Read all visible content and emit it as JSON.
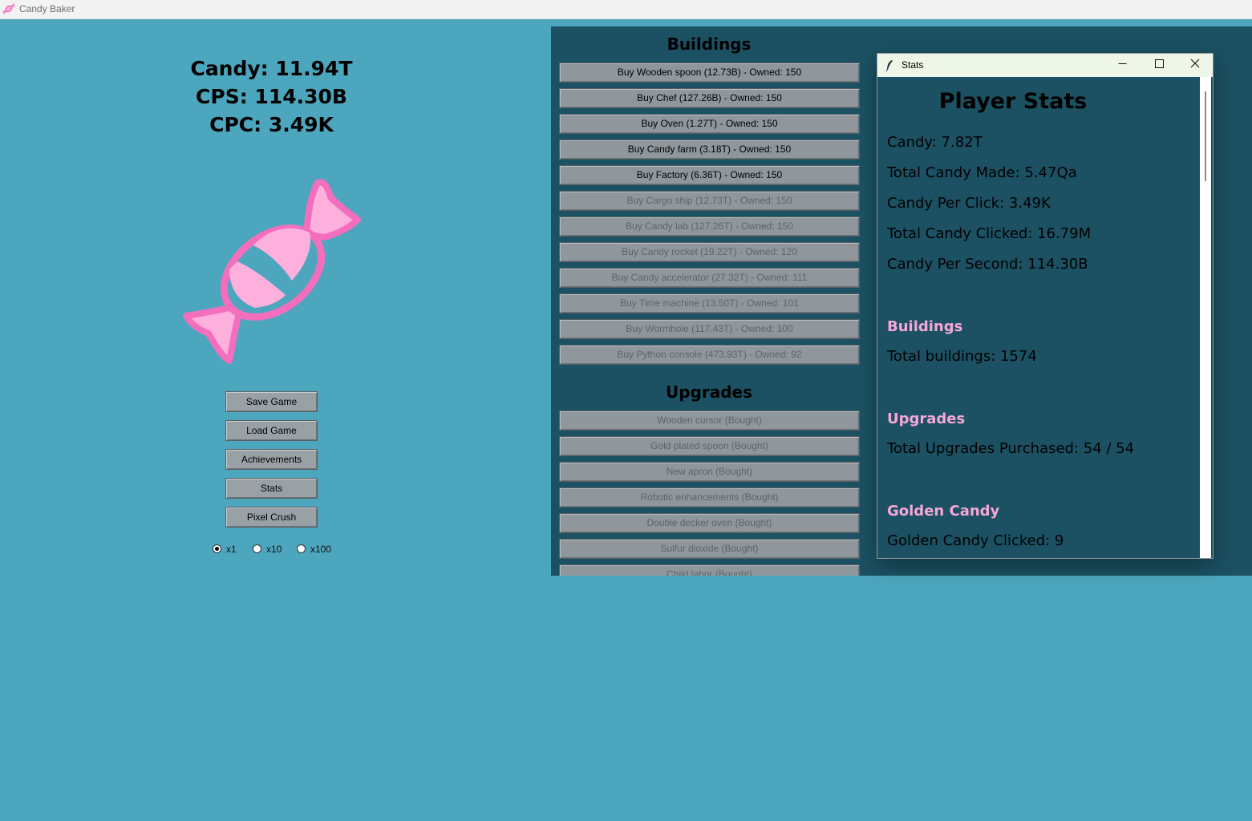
{
  "window": {
    "title": "Candy Baker",
    "icon": "candy-icon"
  },
  "counters": {
    "candy": "Candy: 11.94T",
    "cps": "CPS: 114.30B",
    "cpc": "CPC: 3.49K"
  },
  "candy_graphic": {
    "icon": "wrapped-candy",
    "colors": {
      "outline": "#f36fbe",
      "fill": "#fdb0dc"
    }
  },
  "menu": {
    "save": "Save Game",
    "load": "Load Game",
    "achievements": "Achievements",
    "stats": "Stats",
    "pixel_crush": "Pixel Crush"
  },
  "multiplier": {
    "options": [
      "x1",
      "x10",
      "x100"
    ],
    "selected": "x1"
  },
  "buildings": {
    "heading": "Buildings",
    "items": [
      {
        "label": "Buy Wooden spoon (12.73B) - Owned: 150",
        "enabled": true
      },
      {
        "label": "Buy Chef (127.26B) - Owned: 150",
        "enabled": true
      },
      {
        "label": "Buy Oven (1.27T) - Owned: 150",
        "enabled": true
      },
      {
        "label": "Buy Candy farm (3.18T) - Owned: 150",
        "enabled": true
      },
      {
        "label": "Buy Factory (6.36T) - Owned: 150",
        "enabled": true
      },
      {
        "label": "Buy Cargo ship (12.73T) - Owned: 150",
        "enabled": false
      },
      {
        "label": "Buy Candy lab (127.26T) - Owned: 150",
        "enabled": false
      },
      {
        "label": "Buy Candy rocket (19.22T) - Owned: 120",
        "enabled": false
      },
      {
        "label": "Buy Candy accelerator (27.32T) - Owned: 111",
        "enabled": false
      },
      {
        "label": "Buy Time machine (13.50T) - Owned: 101",
        "enabled": false
      },
      {
        "label": "Buy Wormhole (117.43T) - Owned: 100",
        "enabled": false
      },
      {
        "label": "Buy Python console (473.93T) - Owned: 92",
        "enabled": false
      }
    ]
  },
  "upgrades": {
    "heading": "Upgrades",
    "items": [
      {
        "label": "Wooden cursor (Bought)",
        "enabled": false
      },
      {
        "label": "Gold plated spoon (Bought)",
        "enabled": false
      },
      {
        "label": "New apron (Bought)",
        "enabled": false
      },
      {
        "label": "Robotic enhancements (Bought)",
        "enabled": false
      },
      {
        "label": "Double decker oven (Bought)",
        "enabled": false
      },
      {
        "label": "Sulfur dioxide (Bought)",
        "enabled": false
      },
      {
        "label": "Child labor (Bought)",
        "enabled": false
      }
    ]
  },
  "stats_window": {
    "title": "Stats",
    "heading": "Player Stats",
    "lines": {
      "candy": "Candy: 7.82T",
      "total_made": "Total Candy Made: 5.47Qa",
      "per_click": "Candy Per Click: 3.49K",
      "total_clicked": "Total Candy Clicked: 16.79M",
      "per_second": "Candy Per Second: 114.30B"
    },
    "sections": {
      "buildings": {
        "title": "Buildings",
        "line": "Total buildings: 1574"
      },
      "upgrades": {
        "title": "Upgrades",
        "line": "Total Upgrades Purchased: 54 / 54"
      },
      "golden": {
        "title": "Golden Candy",
        "line": "Golden Candy Clicked: 9"
      }
    },
    "controls": {
      "minimize": "minimize-icon",
      "maximize": "maximize-icon",
      "close": "close-icon"
    },
    "accent": "#f7a6d9"
  }
}
